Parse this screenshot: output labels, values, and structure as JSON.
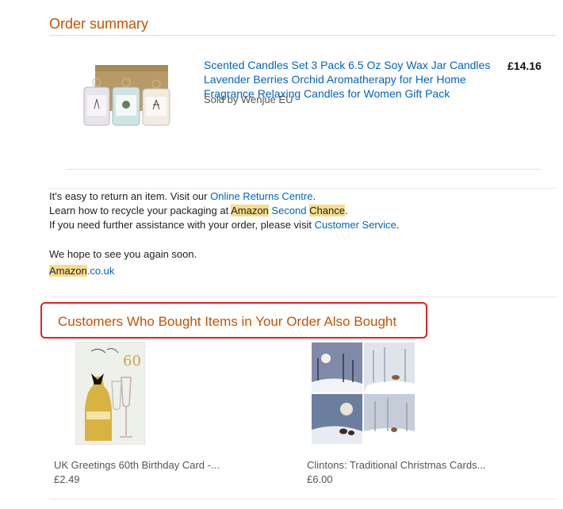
{
  "order": {
    "heading": "Order summary",
    "item": {
      "title_line1": "Scented Candles Set 3 Pack 6.5 Oz Soy Wax Jar Candles",
      "title_line2": "Lavender Berries Orchid Aromatherapy for Her Home",
      "title_line3": "Fragrance Relaxing Candles for Women Gift Pack",
      "seller": "Sold by Wenjue EU",
      "price": "£14.16"
    }
  },
  "info": {
    "line1_prefix": "It's easy to return an item. Visit our ",
    "line1_link": "Online Returns Centre",
    "line1_suffix": ".",
    "line2_prefix": "Learn how to recycle your packaging at ",
    "line2_amazon": "Amazon",
    "line2_second": "Second",
    "line2_chance": "Chance",
    "line2_suffix": ".",
    "line3_prefix": "If you need further assistance with your order, please visit ",
    "line3_link": "Customer Service",
    "line3_suffix": ".",
    "goodbye": "We hope to see you again soon.",
    "signature_brand": "Amazon",
    "signature_domain": ".co.uk"
  },
  "recommendations": {
    "heading": "Customers Who Bought Items in Your Order Also Bought",
    "items": [
      {
        "name": "UK Greetings 60th Birthday Card -...",
        "price": "£2.49"
      },
      {
        "name": "Clintons: Traditional Christmas Cards...",
        "price": "£6.00"
      }
    ]
  },
  "colors": {
    "accent": "#c45500",
    "link": "#0066c0",
    "highlight": "#f7dc8a",
    "annotation": "#e02424"
  }
}
